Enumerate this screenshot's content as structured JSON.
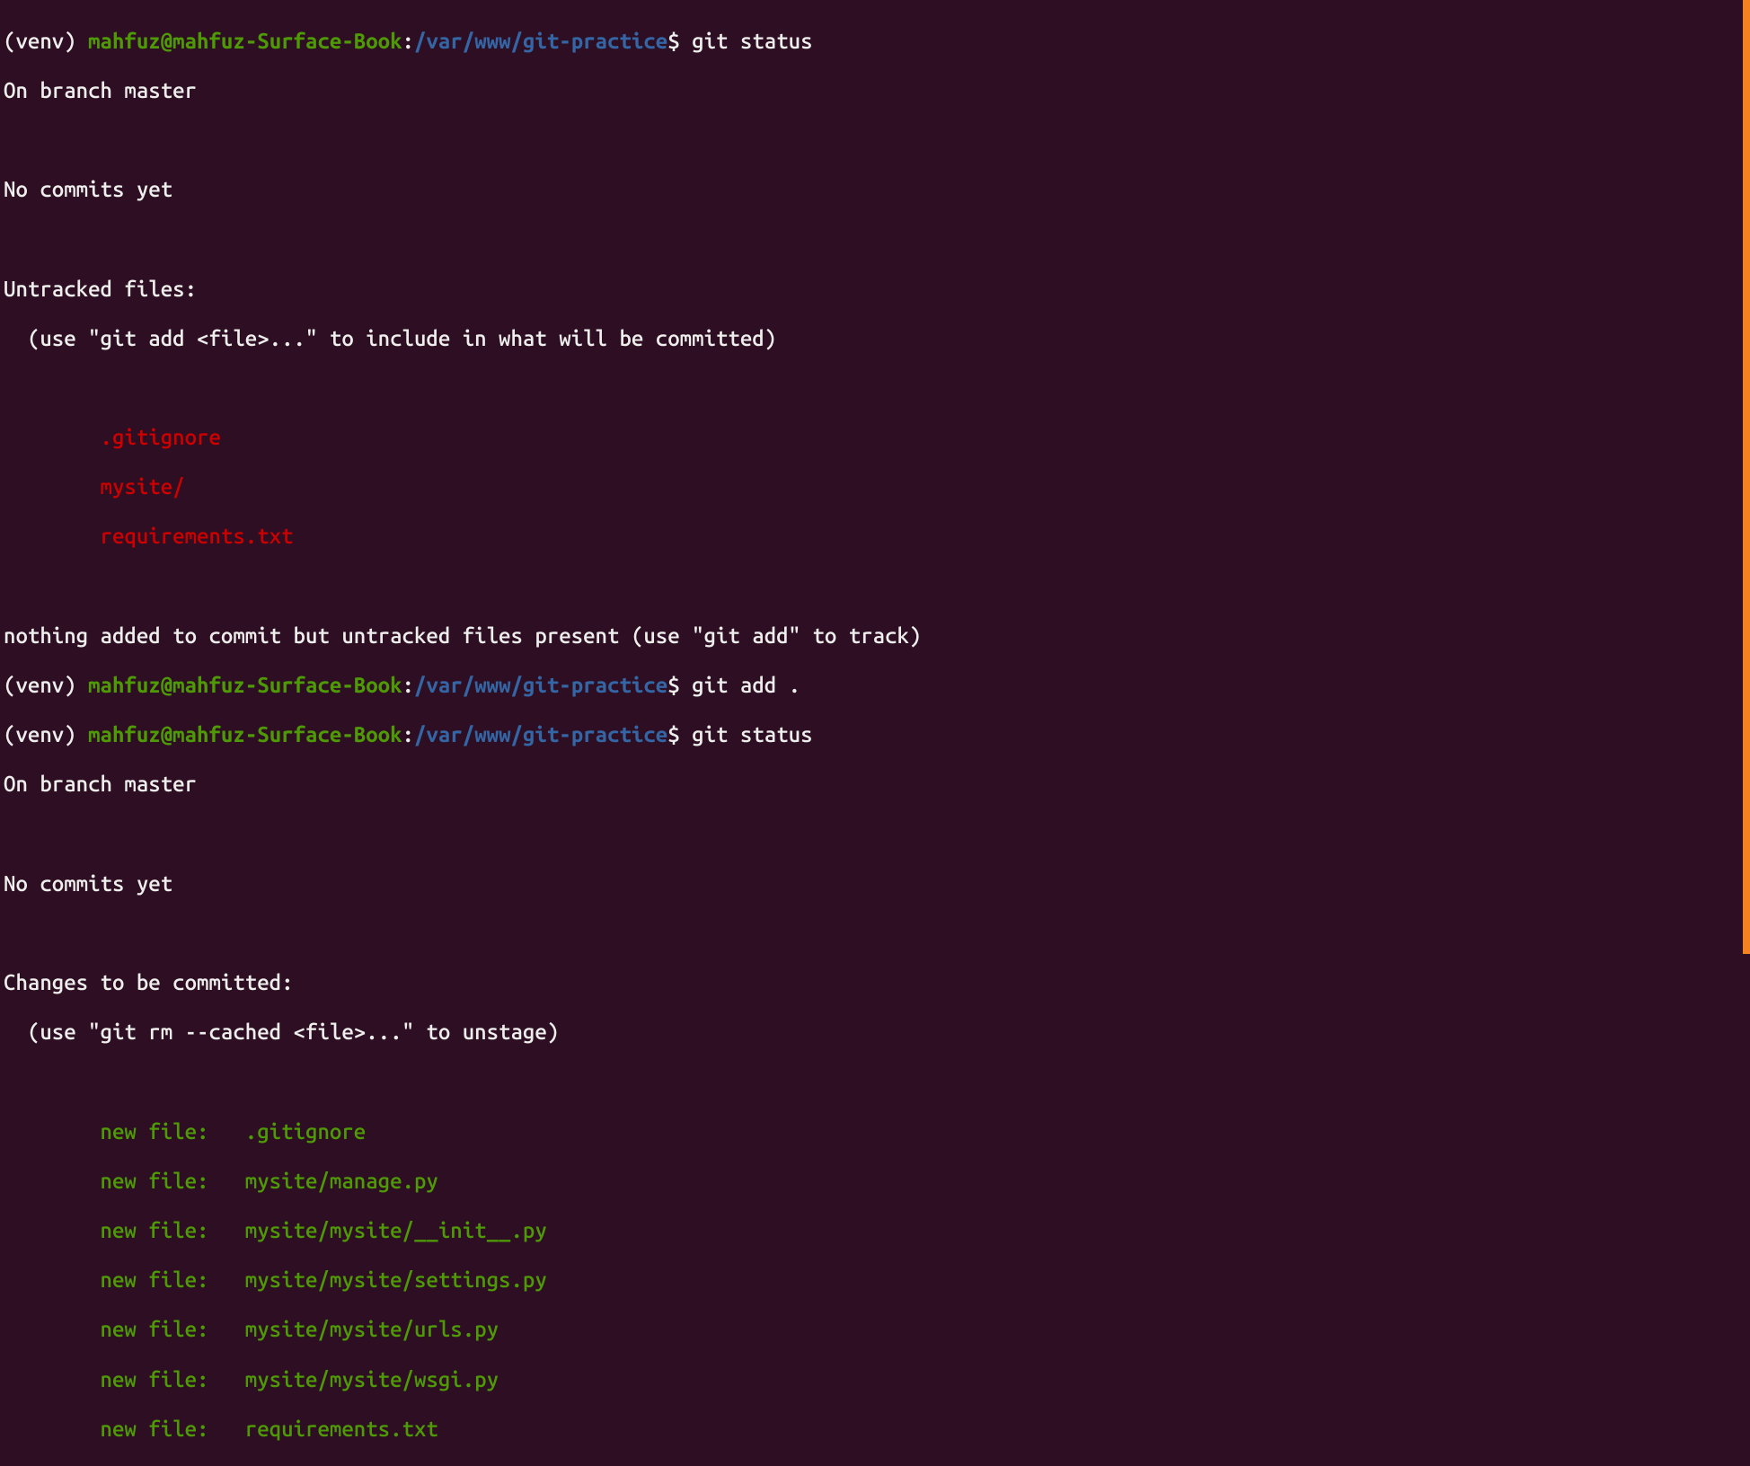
{
  "colors": {
    "background": "#2d0e22",
    "text": "#eeeeec",
    "user": "#4e9a06",
    "path": "#3465a4",
    "untracked": "#cc0000",
    "staged": "#4e9a06",
    "scrollbar": "#f58220"
  },
  "prompt": {
    "env": "(venv) ",
    "user_host": "mahfuz@mahfuz-Surface-Book",
    "colon": ":",
    "path": "/var/www/git-practice",
    "dollar": "$ "
  },
  "commands": {
    "cmd1": "git status",
    "cmd2": "git add .",
    "cmd3": "git status"
  },
  "output1": {
    "branch": "On branch master",
    "no_commits": "No commits yet",
    "untracked_header": "Untracked files:",
    "untracked_hint": "  (use \"git add <file>...\" to include in what will be committed)",
    "files": {
      "f1": "        .gitignore",
      "f2": "        mysite/",
      "f3": "        requirements.txt"
    },
    "nothing_added": "nothing added to commit but untracked files present (use \"git add\" to track)"
  },
  "output2": {
    "branch": "On branch master",
    "no_commits": "No commits yet",
    "changes_header": "Changes to be committed:",
    "changes_hint": "  (use \"git rm --cached <file>...\" to unstage)",
    "files": {
      "f1": "        new file:   .gitignore",
      "f2": "        new file:   mysite/manage.py",
      "f3": "        new file:   mysite/mysite/__init__.py",
      "f4": "        new file:   mysite/mysite/settings.py",
      "f5": "        new file:   mysite/mysite/urls.py",
      "f6": "        new file:   mysite/mysite/wsgi.py",
      "f7": "        new file:   requirements.txt"
    }
  }
}
